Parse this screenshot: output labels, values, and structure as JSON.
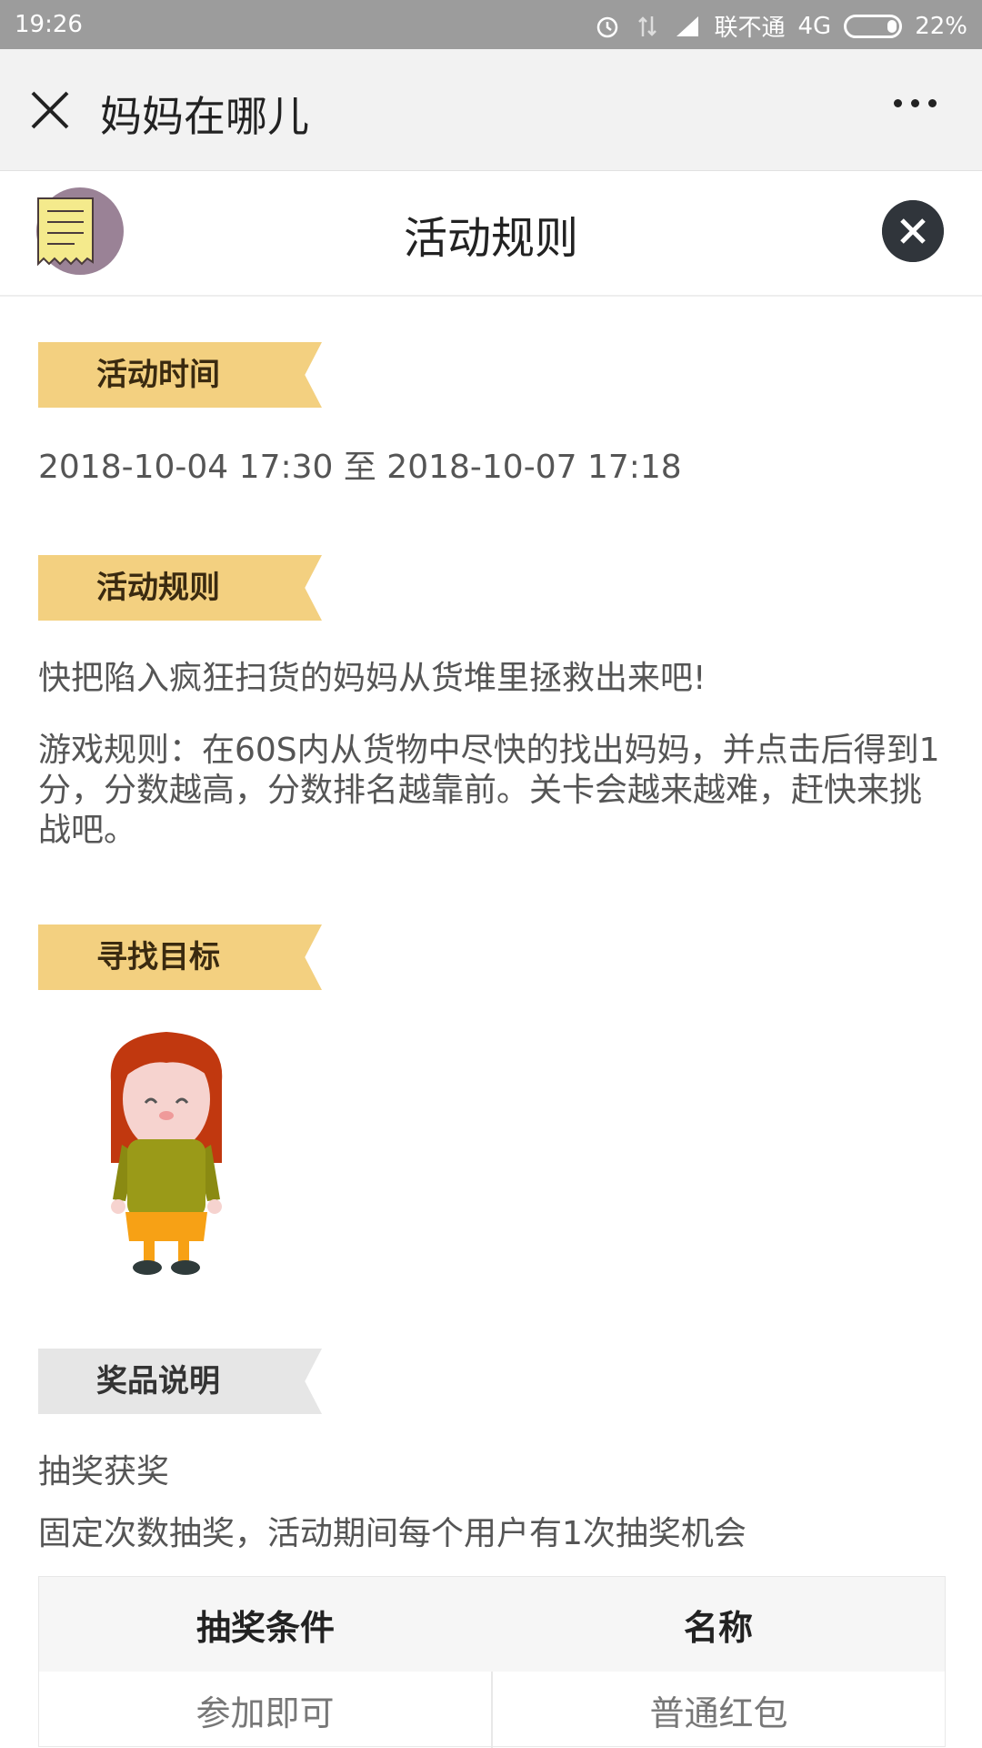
{
  "status_bar": {
    "time": "19:26",
    "carrier": "联不通",
    "network": "4G",
    "battery": "22%"
  },
  "nav": {
    "title": "妈妈在哪儿"
  },
  "panel": {
    "title": "活动规则"
  },
  "sections": {
    "time_tag": "活动时间",
    "time_value": "2018-10-04 17:30 至 2018-10-07 17:18",
    "rules_tag": "活动规则",
    "rules_intro": "快把陷入疯狂扫货的妈妈从货堆里拯救出来吧!",
    "rules_body": "游戏规则：在60S内从货物中尽快的找出妈妈，并点击后得到1分，分数越高，分数排名越靠前。关卡会越来越难，赶快来挑战吧。",
    "target_tag": "寻找目标",
    "prize_tag": "奖品说明",
    "prize_line1": "抽奖获奖",
    "prize_line2": "固定次数抽奖，活动期间每个用户有1次抽奖机会"
  },
  "prize_table": {
    "headers": [
      "抽奖条件",
      "名称"
    ],
    "rows": [
      [
        "参加即可",
        "普通红包"
      ]
    ]
  }
}
